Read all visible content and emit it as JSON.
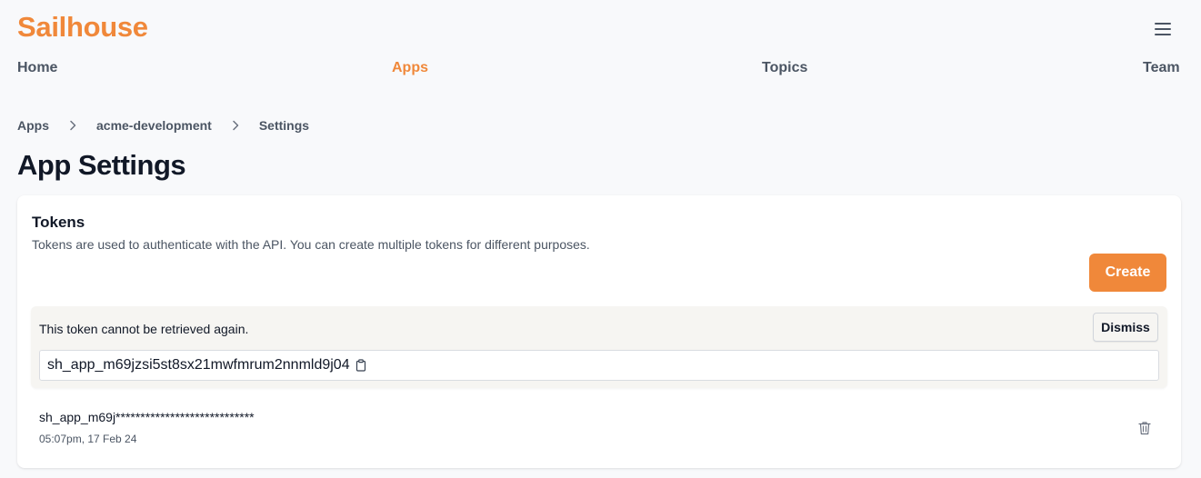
{
  "brand": {
    "name": "Sailhouse",
    "color": "#f0883a"
  },
  "header": {
    "menu_icon": "hamburger-menu-icon"
  },
  "nav": {
    "items": [
      {
        "label": "Home",
        "active": false
      },
      {
        "label": "Apps",
        "active": true
      },
      {
        "label": "Topics",
        "active": false
      },
      {
        "label": "Team",
        "active": false
      }
    ]
  },
  "breadcrumb": {
    "items": [
      "Apps",
      "acme-development",
      "Settings"
    ],
    "separator_icon": "chevron-right-icon"
  },
  "page": {
    "title": "App Settings"
  },
  "tokens": {
    "title": "Tokens",
    "description": "Tokens are used to authenticate with the API. You can create multiple tokens for different purposes.",
    "create_label": "Create",
    "new_token": {
      "warning": "This token cannot be retrieved again.",
      "dismiss_label": "Dismiss",
      "value": "sh_app_m69jzsi5st8sx21mwfmrum2nnmld9j04",
      "copy_icon": "clipboard-icon"
    },
    "list": [
      {
        "masked": "sh_app_m69j****************************",
        "created": "05:07pm, 17 Feb 24",
        "delete_icon": "trash-icon"
      }
    ]
  },
  "colors": {
    "accent": "#f0883a",
    "background": "#f8f9fb",
    "card": "#ffffff",
    "notice_background": "#f6f5f2"
  }
}
